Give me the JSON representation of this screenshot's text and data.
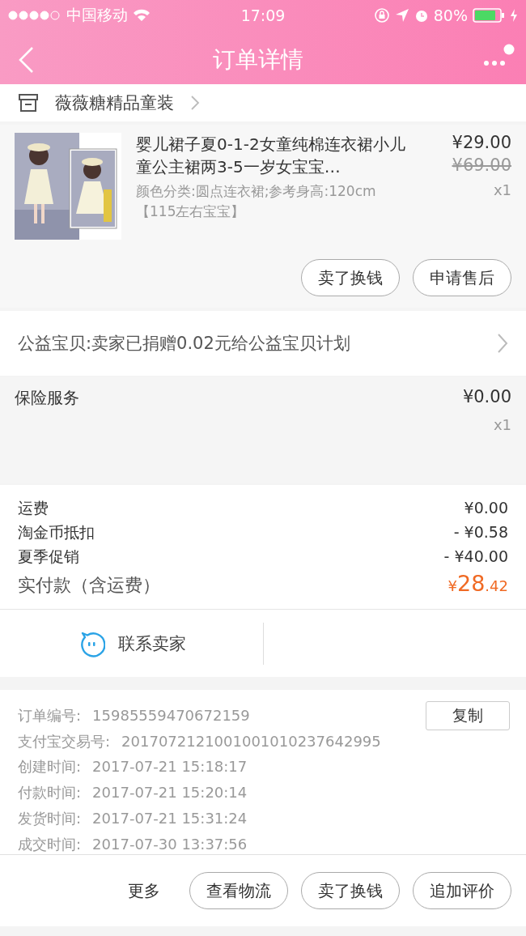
{
  "status_bar": {
    "carrier": "中国移动",
    "time": "17:09",
    "battery": "80%"
  },
  "nav": {
    "title": "订单详情"
  },
  "shop": {
    "name": "薇薇糖精品童装"
  },
  "product": {
    "title": "婴儿裙子夏0-1-2女童纯棉连衣裙小儿童公主裙两3-5一岁女宝宝…",
    "spec": "颜色分类:圆点连衣裙;参考身高:120cm【115左右宝宝】",
    "price": "¥29.00",
    "original_price": "¥69.00",
    "quantity": "x1",
    "image": {
      "kind": "picture"
    },
    "buttons": [
      "卖了换钱",
      "申请售后"
    ]
  },
  "charity": {
    "text": "公益宝贝:卖家已捐赠0.02元给公益宝贝计划"
  },
  "insurance": {
    "label": "保险服务",
    "price": "¥0.00",
    "quantity": "x1"
  },
  "fees": [
    {
      "label": "运费",
      "value": "¥0.00"
    },
    {
      "label": "淘金币抵扣",
      "value": "- ¥0.58"
    },
    {
      "label": "夏季促销",
      "value": "- ¥40.00"
    }
  ],
  "total": {
    "label": "实付款（含运费）",
    "currency": "¥",
    "amount": "28",
    "fraction": ".42"
  },
  "contact": {
    "label": "联系卖家"
  },
  "order_info": {
    "copy_button": "复制",
    "rows": [
      {
        "label": "订单编号:",
        "value": "15985559470672159"
      },
      {
        "label": "支付宝交易号:",
        "value": "2017072121001001010237642995"
      },
      {
        "label": "创建时间:",
        "value": "2017-07-21 15:18:17"
      },
      {
        "label": "付款时间:",
        "value": "2017-07-21 15:20:14"
      },
      {
        "label": "发货时间:",
        "value": "2017-07-21 15:31:24"
      },
      {
        "label": "成交时间:",
        "value": "2017-07-30 13:37:56"
      }
    ]
  },
  "bottom_bar": {
    "more": "更多",
    "buttons": [
      "查看物流",
      "卖了换钱",
      "追加评价"
    ]
  }
}
